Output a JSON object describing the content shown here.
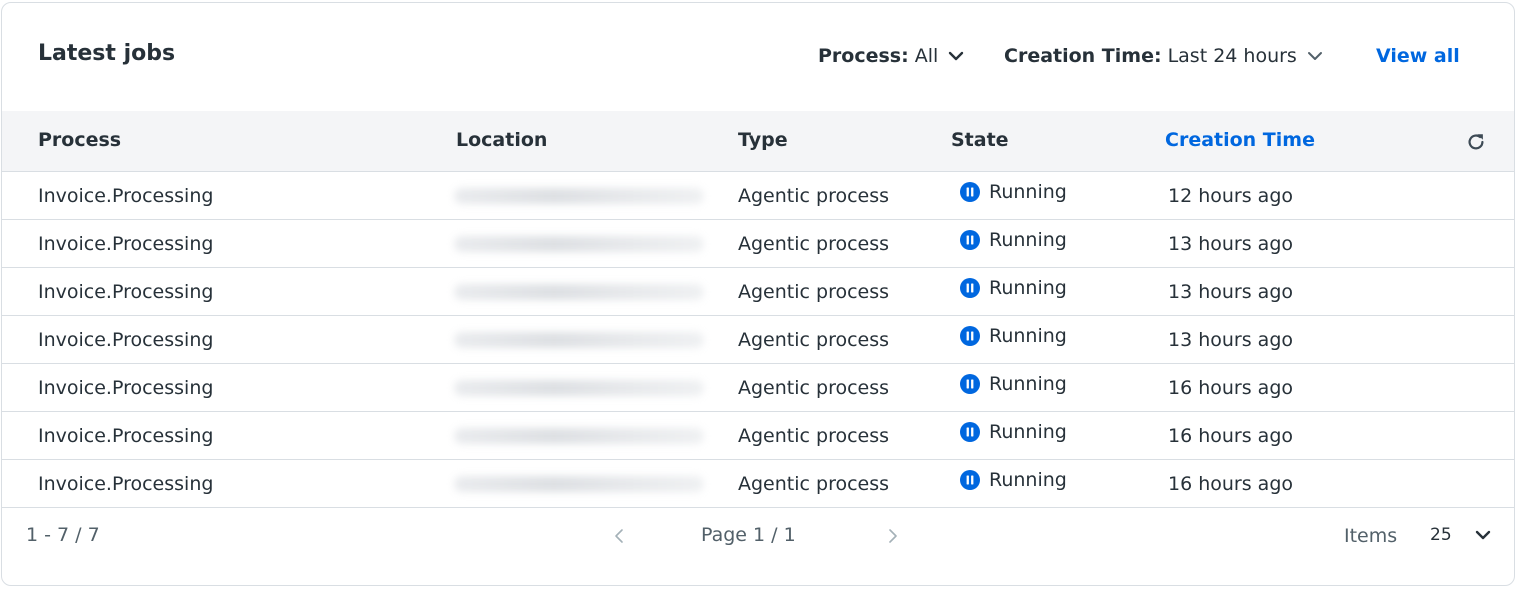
{
  "header": {
    "title": "Latest jobs",
    "process_filter": {
      "label": "Process:",
      "value": "All"
    },
    "time_filter": {
      "label": "Creation Time:",
      "value": "Last 24 hours"
    },
    "view_all": "View all"
  },
  "columns": {
    "process": "Process",
    "location": "Location",
    "type": "Type",
    "state": "State",
    "creation_time": "Creation Time"
  },
  "accent_color": "#0067df",
  "rows": [
    {
      "process": "Invoice.Processing",
      "type": "Agentic process",
      "state": "Running",
      "time": "12 hours ago"
    },
    {
      "process": "Invoice.Processing",
      "type": "Agentic process",
      "state": "Running",
      "time": "13 hours ago"
    },
    {
      "process": "Invoice.Processing",
      "type": "Agentic process",
      "state": "Running",
      "time": "13 hours ago"
    },
    {
      "process": "Invoice.Processing",
      "type": "Agentic process",
      "state": "Running",
      "time": "13 hours ago"
    },
    {
      "process": "Invoice.Processing",
      "type": "Agentic process",
      "state": "Running",
      "time": "16 hours ago"
    },
    {
      "process": "Invoice.Processing",
      "type": "Agentic process",
      "state": "Running",
      "time": "16 hours ago"
    },
    {
      "process": "Invoice.Processing",
      "type": "Agentic process",
      "state": "Running",
      "time": "16 hours ago"
    }
  ],
  "footer": {
    "range": "1 - 7 / 7",
    "page": "Page 1 / 1",
    "items_label": "Items",
    "items_value": "25"
  },
  "icons": {
    "filter_chevron": "chevron-down-icon",
    "refresh": "refresh-icon",
    "state": "pause-circle-icon",
    "prev": "chevron-left-icon",
    "next": "chevron-right-icon"
  }
}
